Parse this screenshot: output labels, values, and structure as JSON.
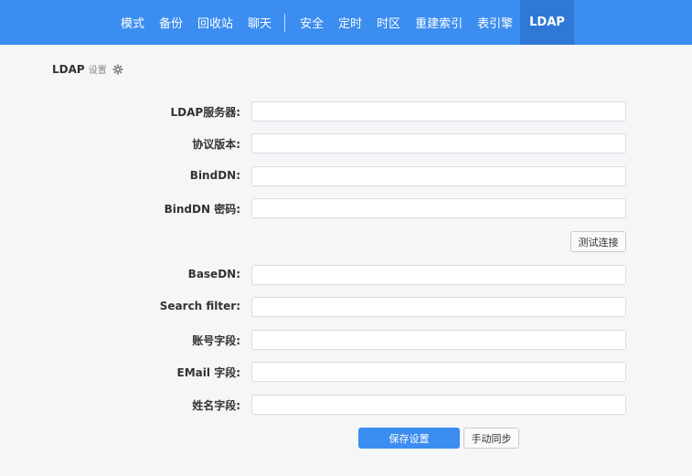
{
  "nav": {
    "items_left": [
      "模式",
      "备份",
      "回收站",
      "聊天"
    ],
    "items_right": [
      "安全",
      "定时",
      "时区",
      "重建索引",
      "表引擎",
      "LDAP"
    ],
    "active": "LDAP"
  },
  "title": {
    "main": "LDAP",
    "sub": "设置",
    "icon": "gear-icon"
  },
  "form": {
    "fields": [
      {
        "label": "LDAP服务器:",
        "value": "",
        "placeholder": ""
      },
      {
        "label": "协议版本:",
        "value": "",
        "placeholder": ""
      },
      {
        "label": "BindDN:",
        "value": "",
        "placeholder": ""
      },
      {
        "label": "BindDN 密码:",
        "value": "",
        "placeholder": ""
      },
      {
        "label": "BaseDN:",
        "value": "",
        "placeholder": ""
      },
      {
        "label": "Search filter:",
        "value": "",
        "placeholder": ""
      },
      {
        "label": "账号字段:",
        "value": "",
        "placeholder": ""
      },
      {
        "label": "EMail 字段:",
        "value": "",
        "placeholder": ""
      },
      {
        "label": "姓名字段:",
        "value": "",
        "placeholder": ""
      }
    ],
    "test_button": "测试连接",
    "save_button": "保存设置",
    "sync_button": "手动同步"
  },
  "colors": {
    "nav_bg": "#3b8df0",
    "nav_active_bg": "#2f78d6",
    "primary": "#3b8df0",
    "page_bg": "#f4f6f8"
  }
}
